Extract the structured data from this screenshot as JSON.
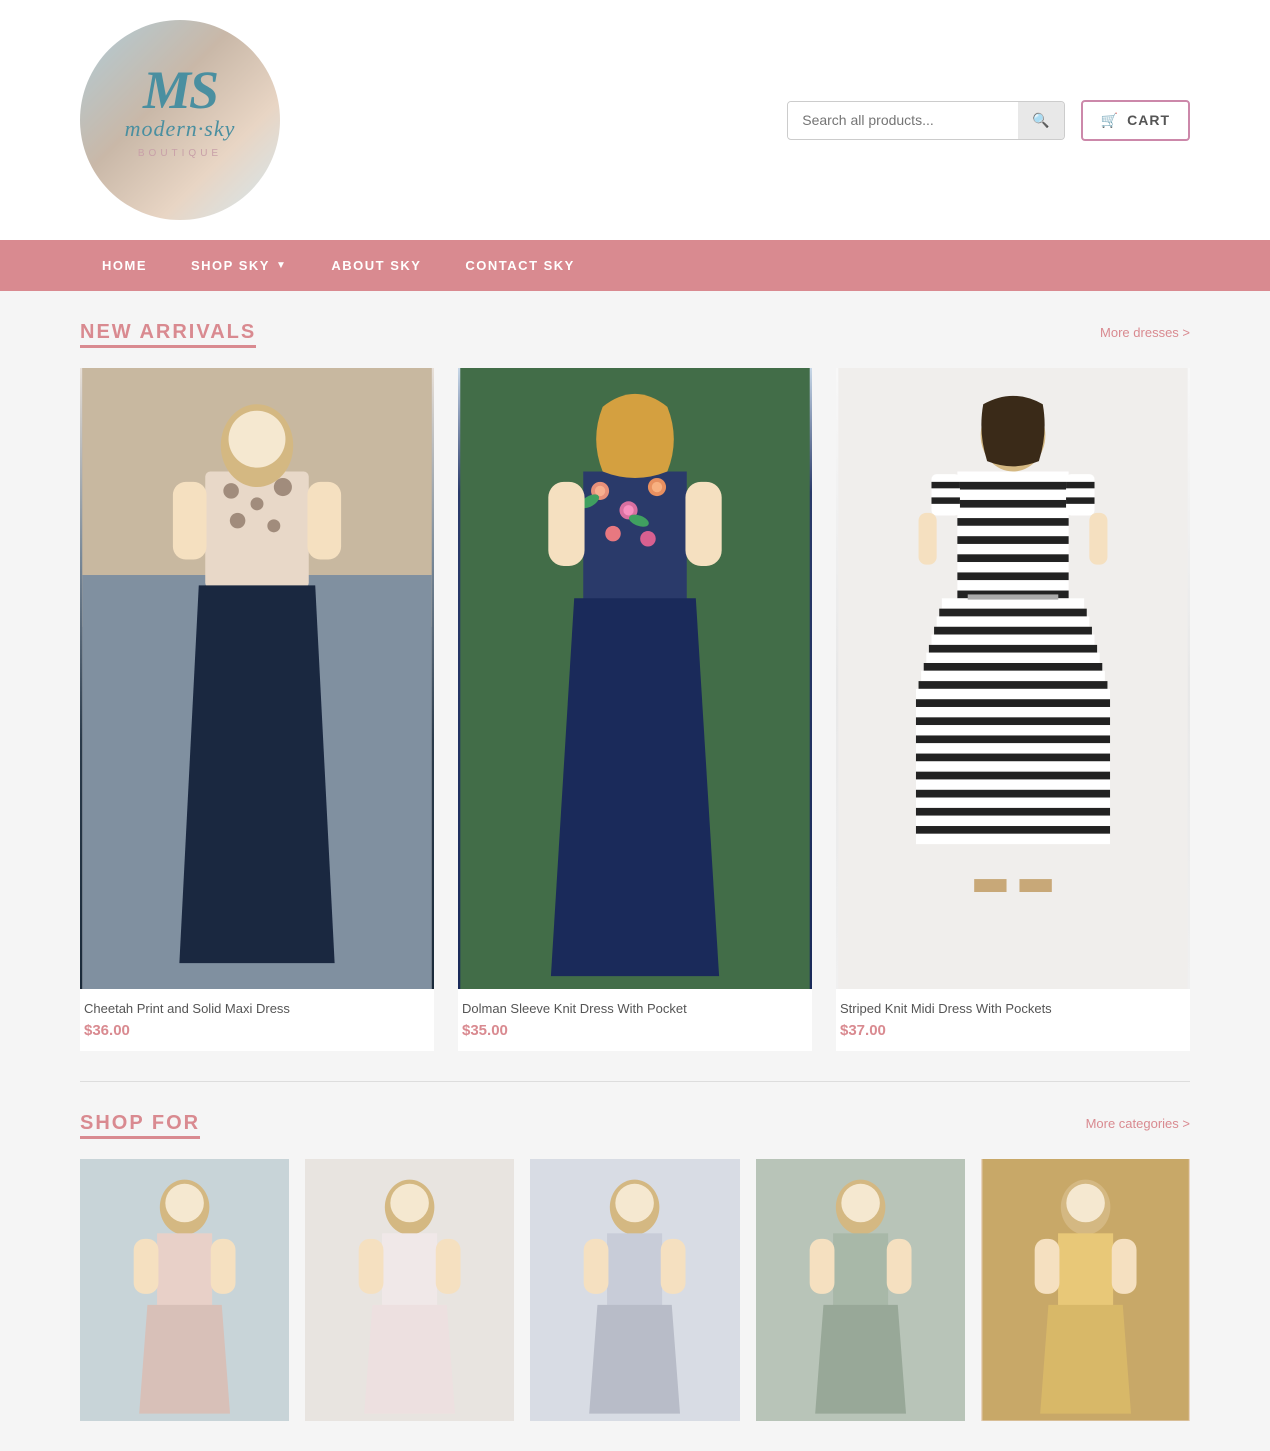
{
  "site": {
    "name": "Modern Sky Boutique",
    "logo_alt": "Modern Sky Boutique Logo"
  },
  "header": {
    "search_placeholder": "Search all products...",
    "search_button_label": "Search",
    "cart_label": "CART"
  },
  "nav": {
    "items": [
      {
        "label": "HOME",
        "id": "home",
        "has_dropdown": false
      },
      {
        "label": "SHOP SKY",
        "id": "shop-sky",
        "has_dropdown": true
      },
      {
        "label": "ABOUT SKY",
        "id": "about-sky",
        "has_dropdown": false
      },
      {
        "label": "CONTACT SKY",
        "id": "contact-sky",
        "has_dropdown": false
      }
    ]
  },
  "new_arrivals": {
    "section_title": "NEW ARRIVALS",
    "more_link": "More dresses >",
    "products": [
      {
        "name": "Cheetah Print and Solid Maxi Dress",
        "price": "$36.00",
        "image_type": "maxi"
      },
      {
        "name": "Dolman Sleeve Knit Dress With Pocket",
        "price": "$35.00",
        "image_type": "floral"
      },
      {
        "name": "Striped Knit Midi Dress With Pockets",
        "price": "$37.00",
        "image_type": "stripe"
      }
    ]
  },
  "shop_for": {
    "section_title": "SHOP FOR",
    "more_link": "More categories >",
    "categories": [
      {
        "id": "cat-1"
      },
      {
        "id": "cat-2"
      },
      {
        "id": "cat-3"
      },
      {
        "id": "cat-4"
      },
      {
        "id": "cat-5"
      }
    ]
  },
  "colors": {
    "nav_bg": "#d98a90",
    "accent": "#d98a90",
    "text_muted": "#555"
  }
}
